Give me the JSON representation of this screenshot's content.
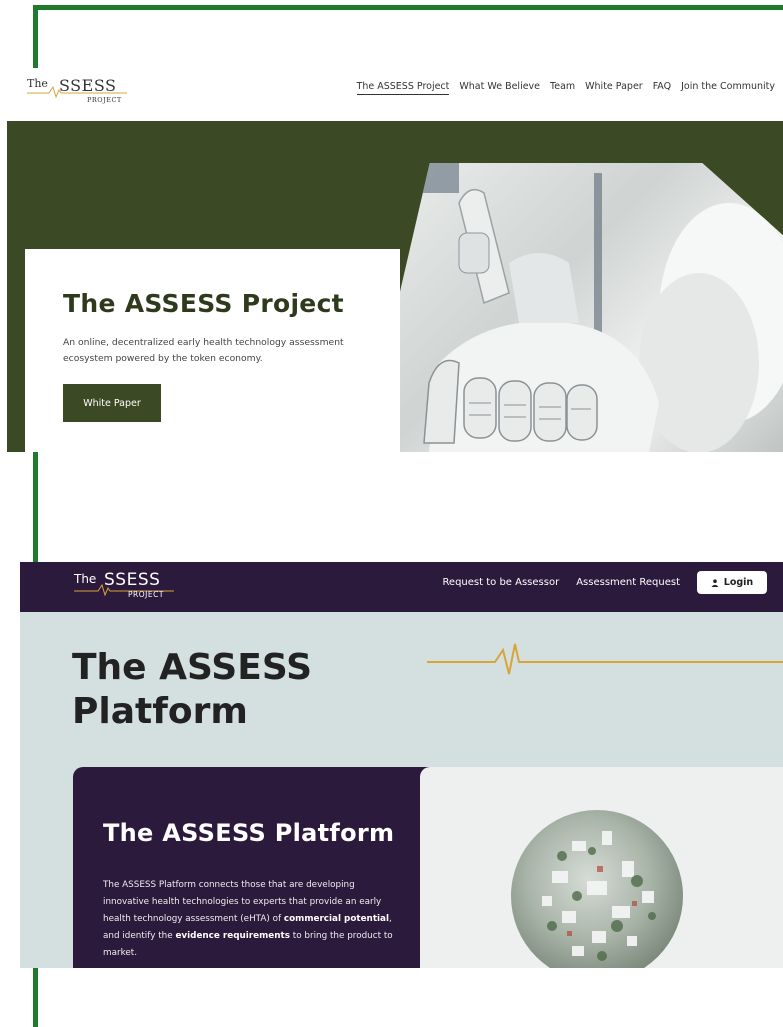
{
  "top_screenshot": {
    "logo": {
      "the": "The",
      "main": "SSESS",
      "project": "PROJECT"
    },
    "nav": [
      {
        "label": "The ASSESS Project"
      },
      {
        "label": "What We Believe"
      },
      {
        "label": "Team"
      },
      {
        "label": "White Paper"
      },
      {
        "label": "FAQ"
      },
      {
        "label": "Join the Community"
      }
    ],
    "hero": {
      "title": "The ASSESS Project",
      "description": "An online, decentralized early health technology assessment ecosystem powered by the token economy.",
      "button": "White Paper"
    }
  },
  "bottom_screenshot": {
    "logo": {
      "the": "The",
      "main": "SSESS",
      "project": "PROJECT"
    },
    "nav": {
      "request_assessor": "Request to be Assessor",
      "assessment_request": "Assessment Request",
      "login": "Login"
    },
    "page_title": "The ASSESS Platform",
    "card": {
      "title": "The ASSESS Platform",
      "desc_intro": "The ASSESS Platform connects those that are developing innovative health technologies to experts that provide an early health technology assessment (eHTA) of ",
      "desc_bold1": "commercial potential",
      "desc_mid": ", and identify the ",
      "desc_bold2": "evidence requirements",
      "desc_end": " to bring the product to market."
    }
  },
  "colors": {
    "frame_green": "#1f7a2b",
    "olive": "#3b4a24",
    "purple": "#2c1a3c",
    "gold": "#d9a43a",
    "mint": "#d4e0df"
  }
}
